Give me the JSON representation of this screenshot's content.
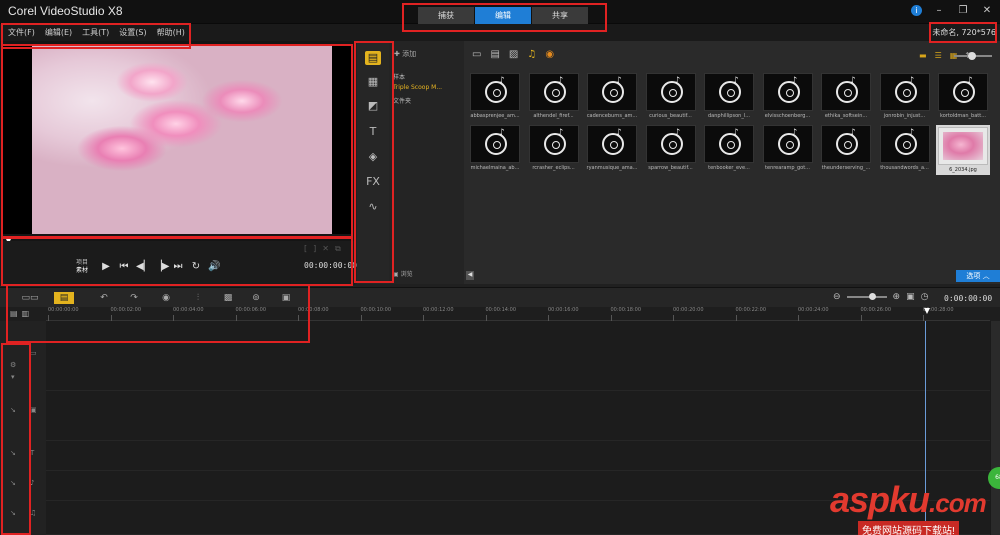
{
  "app": {
    "title": "Corel VideoStudio X8"
  },
  "mode_tabs": [
    {
      "label": "捕获",
      "active": false
    },
    {
      "label": "编辑",
      "active": true
    },
    {
      "label": "共享",
      "active": false
    }
  ],
  "menu": [
    "文件(F)",
    "编辑(E)",
    "工具(T)",
    "设置(S)",
    "帮助(H)"
  ],
  "project_info": "未命名, 720*576",
  "preview": {
    "mode_project": "项目",
    "mode_clip": "素材",
    "timecode": "00:00:00:00"
  },
  "library_nav": {
    "add_label": "添加",
    "folders": [
      "样本",
      "Triple Scoop M...",
      "文件夹"
    ],
    "browse_label": "浏览"
  },
  "library_items": [
    {
      "name": "abbasprenjee_am...",
      "type": "audio"
    },
    {
      "name": "althendel_firef...",
      "type": "audio"
    },
    {
      "name": "cadenceburns_am...",
      "type": "audio"
    },
    {
      "name": "curious_beautif...",
      "type": "audio"
    },
    {
      "name": "danphillipson_l...",
      "type": "audio"
    },
    {
      "name": "elvisschoenberg...",
      "type": "audio"
    },
    {
      "name": "ethika_softsein...",
      "type": "audio"
    },
    {
      "name": "jonrobin_injust...",
      "type": "audio"
    },
    {
      "name": "kortoldman_batt...",
      "type": "audio"
    },
    {
      "name": "michaelmaina_ab...",
      "type": "audio"
    },
    {
      "name": "rcrasher_eclips...",
      "type": "audio"
    },
    {
      "name": "ryanmusique_ama...",
      "type": "audio"
    },
    {
      "name": "sparrow_beautif...",
      "type": "audio"
    },
    {
      "name": "tenbooker_eve...",
      "type": "audio"
    },
    {
      "name": "tenrearamp_got...",
      "type": "audio"
    },
    {
      "name": "theunderserving_...",
      "type": "audio"
    },
    {
      "name": "thousandwords_a...",
      "type": "audio"
    },
    {
      "name": "6_2034.jpg",
      "type": "photo"
    }
  ],
  "options_label": "选项",
  "timeline": {
    "timecode": "0:00:00:00",
    "ruler": [
      "00:00:00:00",
      "00:00:02:00",
      "00:00:04:00",
      "00:00:06:00",
      "00:00:08:00",
      "00:00:10:00",
      "00:00:12:00",
      "00:00:14:00",
      "00:00:16:00",
      "00:00:18:00",
      "00:00:20:00",
      "00:00:22:00",
      "00:00:24:00",
      "00:00:26:00",
      "00:00:28:00"
    ]
  },
  "watermark": {
    "aspku": "aspku",
    "com": ".com",
    "subtitle": "免费网站源码下载站!"
  },
  "colors": {
    "accent": "#1f7ed6",
    "highlight": "#e3b31e",
    "annotation": "#e02222",
    "watermark": "#e23a2f"
  }
}
